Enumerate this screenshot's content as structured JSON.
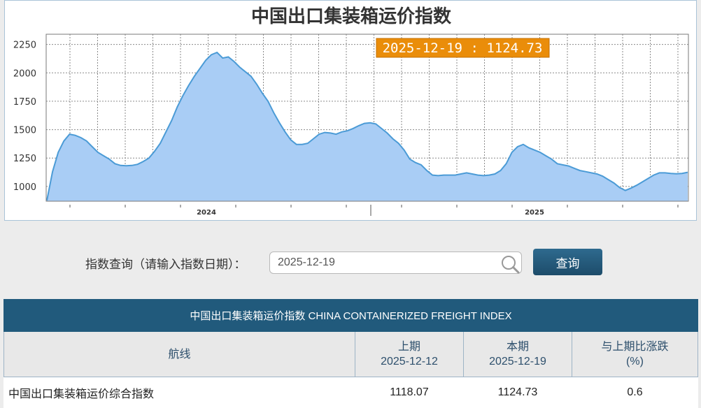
{
  "chart_data": {
    "type": "area",
    "title": "中国出口集装箱运价指数",
    "y_ticks": [
      1000,
      1250,
      1500,
      1750,
      2000,
      2250
    ],
    "ylim": [
      870,
      2340
    ],
    "year_labels": [
      "2024",
      "2025"
    ],
    "tooltip": "2025-12-19 : 1124.73",
    "series": [
      {
        "values": [
          876,
          1130,
          1300,
          1400,
          1460,
          1450,
          1430,
          1400,
          1350,
          1300,
          1270,
          1240,
          1200,
          1185,
          1182,
          1185,
          1195,
          1220,
          1250,
          1310,
          1380,
          1480,
          1580,
          1700,
          1800,
          1890,
          1970,
          2040,
          2110,
          2160,
          2180,
          2130,
          2140,
          2100,
          2050,
          2010,
          1970,
          1900,
          1820,
          1750,
          1650,
          1560,
          1480,
          1410,
          1370,
          1370,
          1380,
          1420,
          1460,
          1475,
          1470,
          1460,
          1480,
          1490,
          1510,
          1535,
          1555,
          1560,
          1550,
          1510,
          1470,
          1420,
          1380,
          1320,
          1240,
          1210,
          1190,
          1140,
          1100,
          1095,
          1100,
          1100,
          1100,
          1110,
          1120,
          1110,
          1100,
          1095,
          1100,
          1110,
          1140,
          1200,
          1300,
          1350,
          1370,
          1340,
          1320,
          1300,
          1270,
          1240,
          1200,
          1190,
          1180,
          1160,
          1140,
          1130,
          1120,
          1110,
          1090,
          1060,
          1030,
          990,
          965,
          985,
          1010,
          1040,
          1070,
          1100,
          1120,
          1120,
          1115,
          1112,
          1115,
          1124.73
        ]
      }
    ]
  },
  "query": {
    "label": "指数查询（请输入指数日期）：",
    "date_value": "2025-12-19",
    "button_label": "查询"
  },
  "table": {
    "caption": "中国出口集装箱运价指数 CHINA CONTAINERIZED FREIGHT INDEX",
    "headers": {
      "route": "航线",
      "prev_label": "上期",
      "prev_date": "2025-12-12",
      "curr_label": "本期",
      "curr_date": "2025-12-19",
      "change_label": "与上期比涨跌",
      "change_unit": "(%)"
    },
    "rows": [
      {
        "route": "中国出口集装箱运价综合指数",
        "prev": "1118.07",
        "curr": "1124.73",
        "change": "0.6"
      }
    ]
  },
  "colors": {
    "area_fill": "#a9cdf5",
    "line": "#4b9bd6",
    "tooltip_bg": "#ea8d0a",
    "table_header_bg": "#215a7c",
    "button_bg": "#2a5f80"
  }
}
